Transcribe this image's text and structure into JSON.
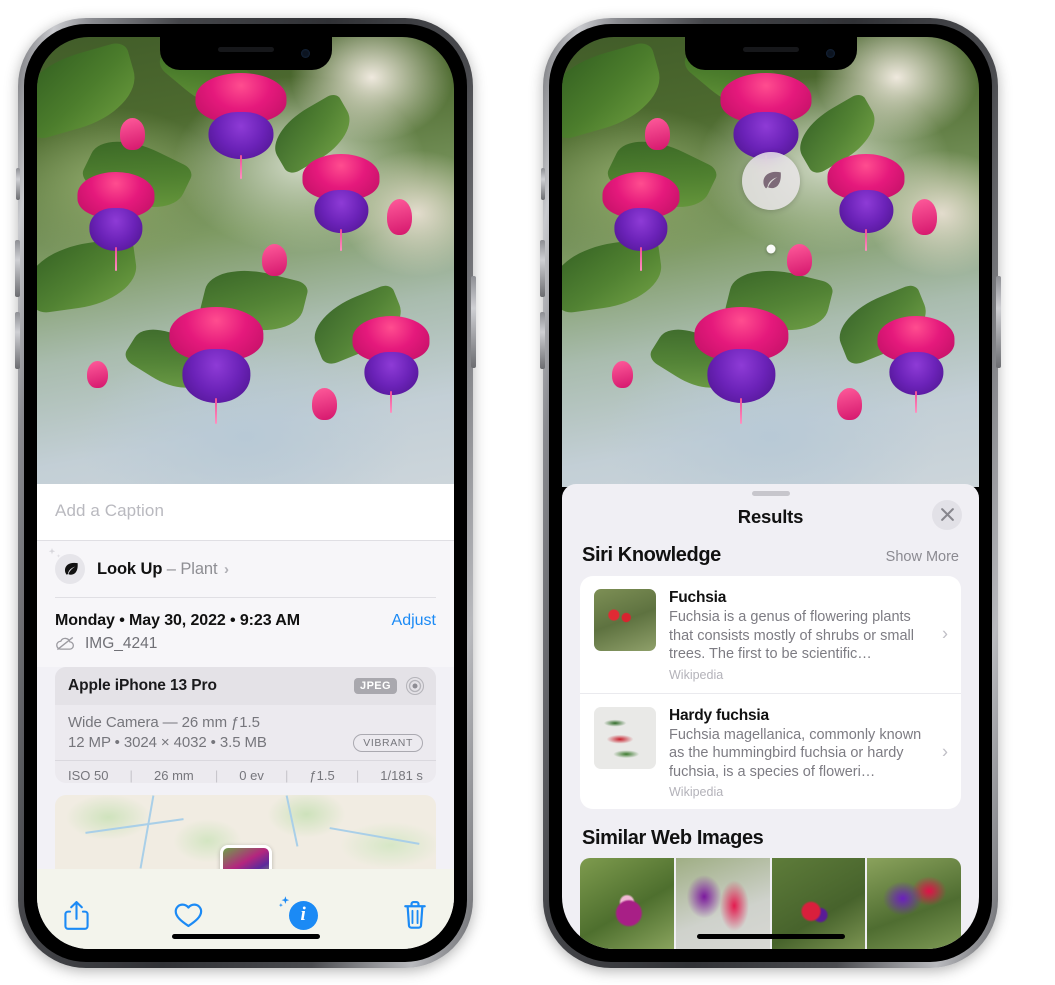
{
  "left_phone": {
    "caption_placeholder": "Add a Caption",
    "lookup": {
      "label": "Look Up",
      "separator": "–",
      "subject": "Plant",
      "chevron": "›",
      "icon": "leaf-icon"
    },
    "date_line": "Monday • May 30, 2022 • 9:23 AM",
    "adjust_label": "Adjust",
    "file_name": "IMG_4241",
    "cloud_icon": "icloud-slash-icon",
    "camera": {
      "device": "Apple iPhone 13 Pro",
      "format_badge": "JPEG",
      "aperture_icon": "aperture-icon",
      "lens_line": "Wide Camera — 26 mm ƒ1.5",
      "resolution_line": "12 MP • 3024 × 4032 • 3.5 MB",
      "style_badge": "VIBRANT",
      "exif": [
        "ISO 50",
        "26 mm",
        "0 ev",
        "ƒ1.5",
        "1/181 s"
      ],
      "exif_separator": "|"
    },
    "toolbar": [
      {
        "name": "share-button",
        "icon": "share-icon"
      },
      {
        "name": "favorite-button",
        "icon": "heart-icon"
      },
      {
        "name": "info-button",
        "icon": "info-sparkle-icon"
      },
      {
        "name": "delete-button",
        "icon": "trash-icon"
      }
    ]
  },
  "right_phone": {
    "sheet_title": "Results",
    "close_icon": "close-icon",
    "grabber": "drag-handle",
    "badge": {
      "icon": "leaf-icon"
    },
    "siri_knowledge": {
      "title": "Siri Knowledge",
      "show_more": "Show More",
      "items": [
        {
          "name": "Fuchsia",
          "description": "Fuchsia is a genus of flowering plants that consists mostly of shrubs or small trees. The first to be scientific…",
          "source": "Wikipedia",
          "chevron": "›"
        },
        {
          "name": "Hardy fuchsia",
          "description": "Fuchsia magellanica, commonly known as the hummingbird fuchsia or hardy fuchsia, is a species of floweri…",
          "source": "Wikipedia",
          "chevron": "›"
        }
      ]
    },
    "similar_web_images": {
      "title": "Similar Web Images",
      "tiles": [
        "web-image-1",
        "web-image-2",
        "web-image-3",
        "web-image-4"
      ]
    }
  },
  "colors": {
    "accent_blue": "#1b8af5",
    "sheet_left_bg": "#f7f6f9",
    "sheet_right_bg": "#f0eff4",
    "card_white": "#ffffff",
    "secondary_text": "#8e8e93"
  }
}
